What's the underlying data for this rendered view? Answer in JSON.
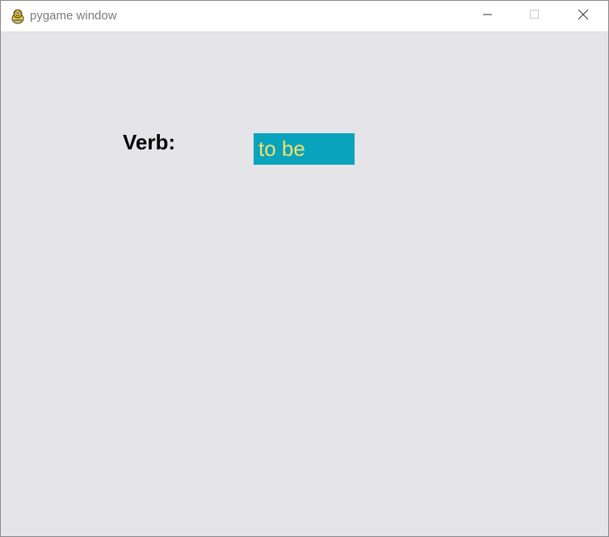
{
  "window": {
    "title": "pygame window",
    "app_icon": "pygame-snake-icon",
    "controls": {
      "minimize_icon": "minimize-icon",
      "maximize_icon": "maximize-icon",
      "close_icon": "close-icon"
    }
  },
  "content": {
    "verb_label": "Verb:",
    "verb_value": "to be",
    "colors": {
      "background": "#e4e4e9",
      "verb_box": "#0aa3bd",
      "verb_text": "#f3e06a",
      "label_text": "#000000"
    }
  }
}
